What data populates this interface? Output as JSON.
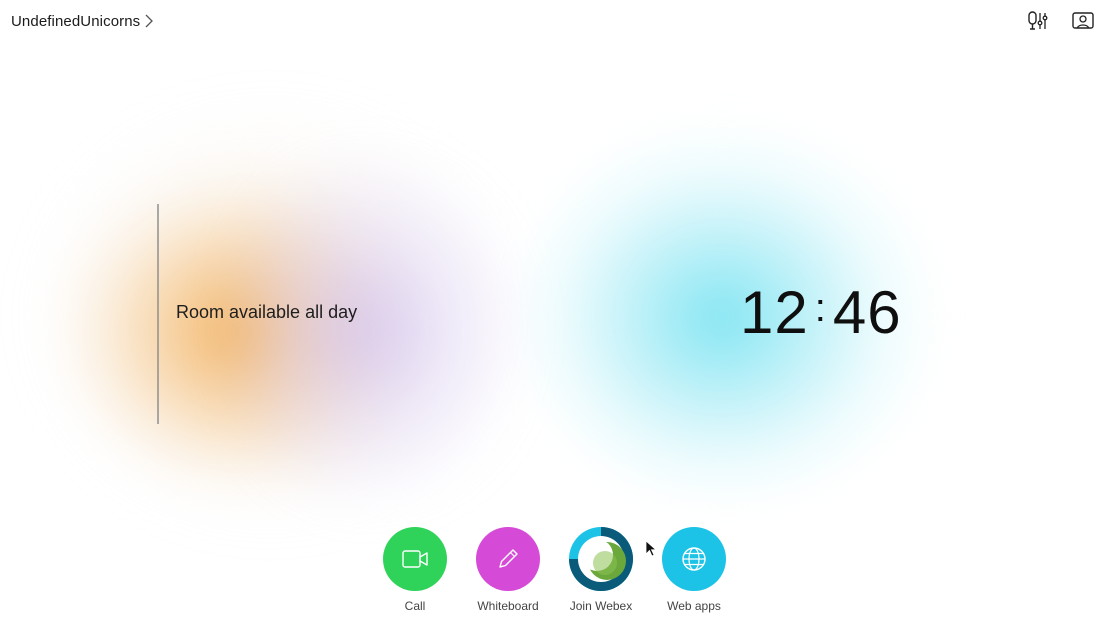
{
  "header": {
    "room_name": "UndefinedUnicorns",
    "icons": [
      "chevron-right-icon",
      "microphone-settings-icon",
      "selfview-icon"
    ]
  },
  "status": {
    "availability": "Room available all day"
  },
  "clock": {
    "hours": "12",
    "separator": ":",
    "minutes": "46"
  },
  "dock": {
    "items": [
      {
        "label": "Call",
        "icon": "video-camera-icon",
        "color": "#2fd35a"
      },
      {
        "label": "Whiteboard",
        "icon": "pencil-icon",
        "color": "#d64ad8"
      },
      {
        "label": "Join Webex",
        "icon": "webex-logo-icon",
        "color": "#1cc3e6"
      },
      {
        "label": "Web apps",
        "icon": "globe-icon",
        "color": "#1cc3e6"
      }
    ]
  },
  "colors": {
    "glow_orange": "#f2a846",
    "glow_violet": "#cdbef5",
    "glow_cyan": "#6ee1f0"
  }
}
